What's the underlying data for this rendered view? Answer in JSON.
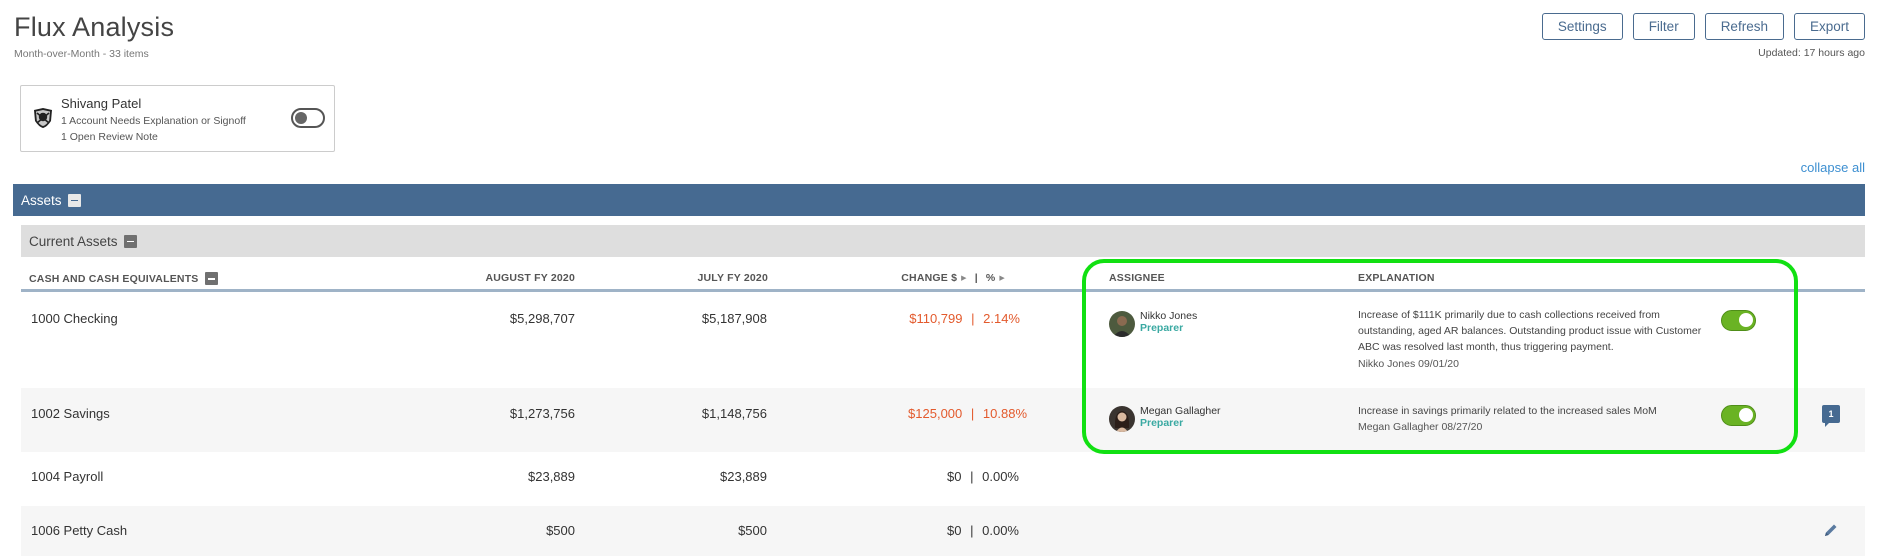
{
  "header": {
    "title": "Flux Analysis",
    "subtitle": "Month-over-Month - 33 items",
    "updated": "Updated: 17 hours ago"
  },
  "toolbar": {
    "settings": "Settings",
    "filter": "Filter",
    "refresh": "Refresh",
    "export": "Export"
  },
  "user_card": {
    "name": "Shivang Patel",
    "line1": "1 Account Needs Explanation or Signoff",
    "line2": "1 Open Review Note"
  },
  "collapse_all": "collapse all",
  "sections": {
    "assets": "Assets",
    "current_assets": "Current Assets"
  },
  "columns": {
    "account": "CASH AND CASH EQUIVALENTS",
    "august": "AUGUST FY 2020",
    "july": "JULY FY 2020",
    "change": "CHANGE $",
    "sep": "|",
    "pct": "%",
    "assignee": "ASSIGNEE",
    "explanation": "EXPLANATION"
  },
  "rows": [
    {
      "account": "1000 Checking",
      "august": "$5,298,707",
      "july": "$5,187,908",
      "change": "$110,799",
      "pct": "2.14%",
      "assignee": "Nikko Jones",
      "role": "Preparer",
      "explanation": "Increase of $111K  primarily due to cash collections received from outstanding, aged AR balances. Outstanding product issue with Customer ABC was resolved last month, thus triggering payment.",
      "signoff": "Nikko Jones 09/01/20"
    },
    {
      "account": "1002 Savings",
      "august": "$1,273,756",
      "july": "$1,148,756",
      "change": "$125,000",
      "pct": "10.88%",
      "assignee": "Megan Gallagher",
      "role": "Preparer",
      "explanation": "Increase in savings primarily related to the increased sales MoM",
      "signoff": "Megan Gallagher 08/27/20",
      "note_count": "1"
    },
    {
      "account": "1004 Payroll",
      "august": "$23,889",
      "july": "$23,889",
      "change": "$0",
      "pct": "0.00%"
    },
    {
      "account": "1006 Petty Cash",
      "august": "$500",
      "july": "$500",
      "change": "$0",
      "pct": "0.00%"
    }
  ],
  "colors": {
    "section_header": "#466a91",
    "subsection_header": "#dedede",
    "change_positive": "#e35a2d",
    "toggle_on": "#6ab324",
    "role_text": "#3aa9a2",
    "highlight": "#11e012"
  }
}
